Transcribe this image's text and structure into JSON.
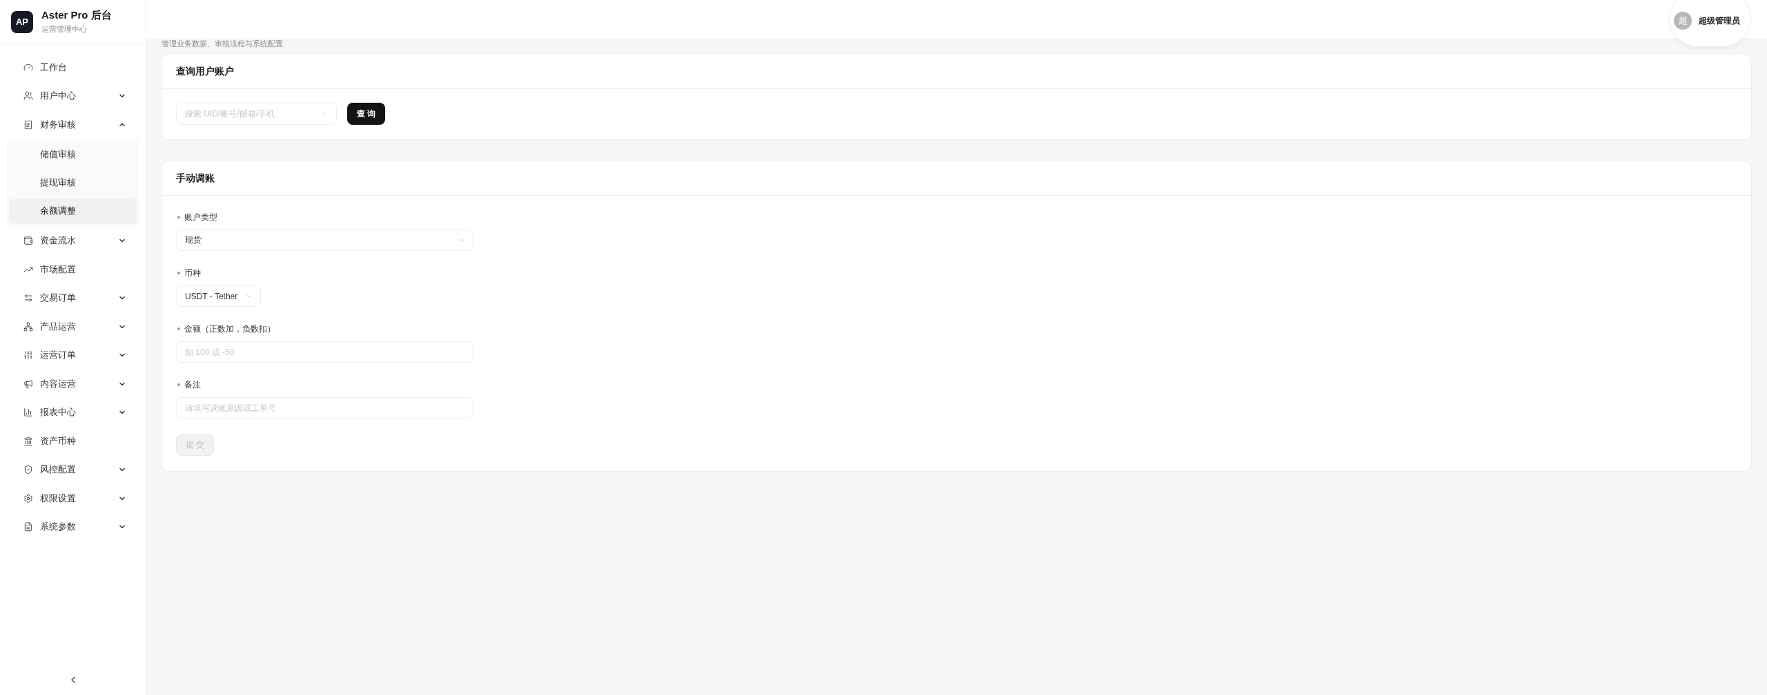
{
  "sidebar": {
    "logo": "AP",
    "title": "Aster Pro 后台",
    "subtitle": "运营管理中心",
    "items": [
      {
        "kind": "link",
        "label": "工作台",
        "selected": false
      },
      {
        "kind": "group",
        "label": "用户中心",
        "selected": false,
        "expanded": false
      },
      {
        "kind": "group",
        "label": "财务审核",
        "selected": false,
        "expanded": true,
        "children": [
          {
            "label": "储值审核",
            "selected": false
          },
          {
            "label": "提现审核",
            "selected": false
          },
          {
            "label": "余额调整",
            "selected": true
          }
        ]
      },
      {
        "kind": "group",
        "label": "资金流水",
        "selected": false,
        "expanded": false
      },
      {
        "kind": "link",
        "label": "市场配置",
        "selected": false
      },
      {
        "kind": "group",
        "label": "交易订单",
        "selected": false,
        "expanded": false
      },
      {
        "kind": "group",
        "label": "产品运营",
        "selected": false,
        "expanded": false
      },
      {
        "kind": "group",
        "label": "运营订单",
        "selected": false,
        "expanded": false
      },
      {
        "kind": "group",
        "label": "内容运营",
        "selected": false,
        "expanded": false
      },
      {
        "kind": "group",
        "label": "报表中心",
        "selected": false,
        "expanded": false
      },
      {
        "kind": "link",
        "label": "资产币种",
        "selected": false
      },
      {
        "kind": "group",
        "label": "风控配置",
        "selected": false,
        "expanded": false
      },
      {
        "kind": "group",
        "label": "权限设置",
        "selected": false,
        "expanded": false
      },
      {
        "kind": "group",
        "label": "系统参数",
        "selected": false,
        "expanded": false
      }
    ]
  },
  "header": {
    "user": {
      "avatar": "超",
      "name": "超级管理员"
    }
  },
  "page_subtitle": "管理业务数据、审核流程与系统配置",
  "query_card": {
    "title": "查询用户账户",
    "search": {
      "placeholder": "搜索 UID/账号/邮箱/手机"
    },
    "button": "查 询"
  },
  "adjust_card": {
    "title": "手动调账",
    "fields": [
      {
        "kind": "select",
        "label": "账户类型",
        "required": true,
        "value": "现货"
      },
      {
        "kind": "compact-select",
        "label": "币种",
        "required": true,
        "value": "USDT - Tether"
      },
      {
        "kind": "input",
        "label": "金额（正数加，负数扣）",
        "required": true,
        "placeholder": "如 100 或 -50"
      },
      {
        "kind": "input",
        "label": "备注",
        "required": true,
        "placeholder": "请填写调账原因或工单号"
      }
    ],
    "submit": {
      "label": "提 交",
      "disabled": true
    }
  }
}
